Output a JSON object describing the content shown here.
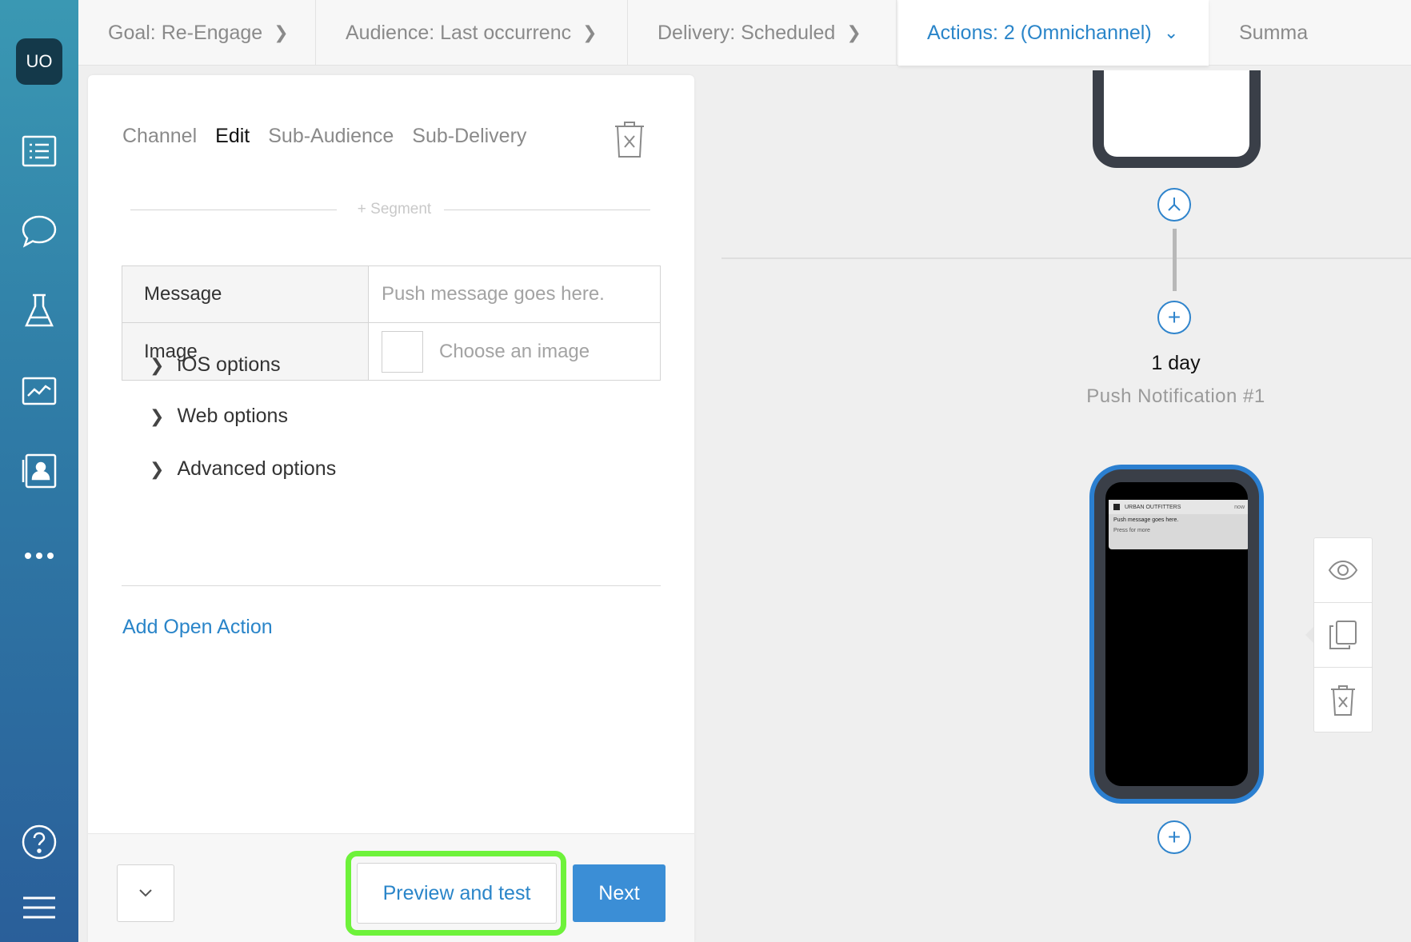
{
  "sidebar": {
    "avatar_initials": "UO",
    "icons": [
      "list-icon",
      "chat-bubble-icon",
      "flask-icon",
      "chart-icon",
      "contact-card-icon",
      "more-dots-icon",
      "help-icon",
      "menu-icon"
    ]
  },
  "topbar": {
    "tabs": [
      {
        "label": "Goal: Re-Engage"
      },
      {
        "label": "Audience: Last occurrenc"
      },
      {
        "label": "Delivery: Scheduled"
      },
      {
        "label": "Actions: 2 (Omnichannel)",
        "active": true
      },
      {
        "label": "Summa"
      }
    ]
  },
  "panel": {
    "subtabs": [
      "Channel",
      "Edit",
      "Sub-Audience",
      "Sub-Delivery"
    ],
    "active_subtab": "Edit",
    "segment_label": "+ Segment",
    "form": {
      "message_label": "Message",
      "message_placeholder": "Push message goes here.",
      "image_label": "Image",
      "image_placeholder": "Choose an image"
    },
    "options": [
      "iOS options",
      "Web options",
      "Advanced options"
    ],
    "add_open_action": "Add Open Action",
    "footer": {
      "preview_label": "Preview and test",
      "next_label": "Next"
    }
  },
  "canvas": {
    "delay_label": "1 day",
    "notification_name": "Push Notification #1",
    "preview": {
      "brand": "URBAN OUTFITTERS",
      "time": "now",
      "message": "Push message goes here.",
      "more": "Press for more"
    },
    "tools": [
      "eye-icon",
      "copy-icon",
      "trash-icon"
    ]
  },
  "colors": {
    "accent": "#2a85c9",
    "button": "#3b8ed6",
    "highlight": "#6ef23a",
    "sidebar_top": "#3a98b3",
    "sidebar_bottom": "#2a5f9a"
  }
}
